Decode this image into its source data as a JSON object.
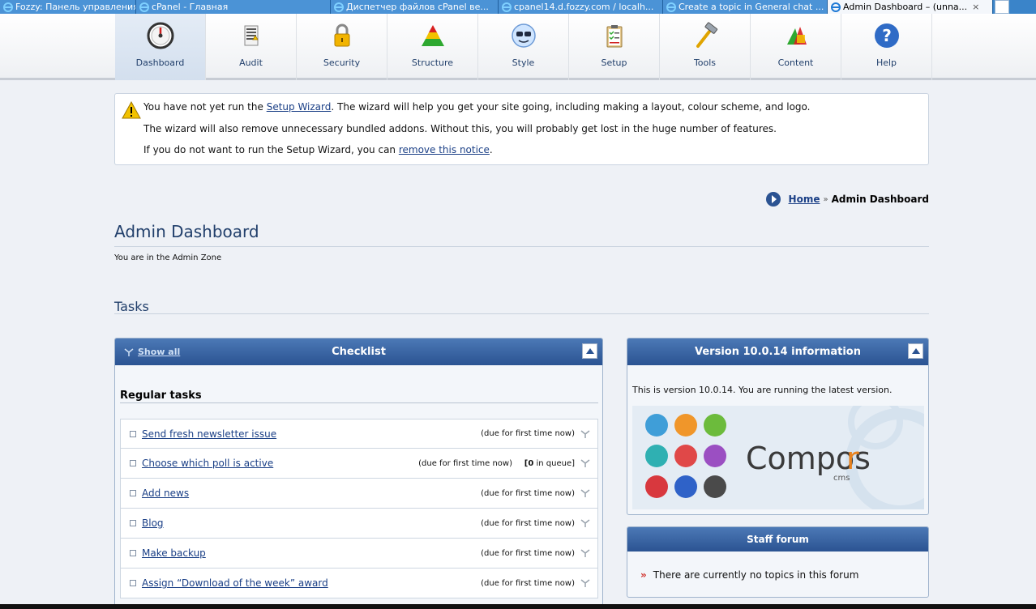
{
  "browser_tabs": [
    {
      "title": "Fozzy: Панель управления",
      "active": false
    },
    {
      "title": "cPanel - Главная",
      "active": false
    },
    {
      "title": "Диспетчер файлов cPanel ве...",
      "active": false
    },
    {
      "title": "cpanel14.d.fozzy.com / localh...",
      "active": false
    },
    {
      "title": "Create a topic in General chat ...",
      "active": false
    },
    {
      "title": "Admin Dashboard – (unna...",
      "active": true
    }
  ],
  "tab_close": "×",
  "toolbar": {
    "items": [
      {
        "label": "Dashboard",
        "icon": "dashboard-gauge-icon",
        "active": true
      },
      {
        "label": "Audit",
        "icon": "audit-icon",
        "active": false
      },
      {
        "label": "Security",
        "icon": "padlock-icon",
        "active": false
      },
      {
        "label": "Structure",
        "icon": "pyramid-icon",
        "active": false
      },
      {
        "label": "Style",
        "icon": "sunglasses-face-icon",
        "active": false
      },
      {
        "label": "Setup",
        "icon": "clipboard-checklist-icon",
        "active": false
      },
      {
        "label": "Tools",
        "icon": "hammer-icon",
        "active": false
      },
      {
        "label": "Content",
        "icon": "content-shapes-icon",
        "active": false
      },
      {
        "label": "Help",
        "icon": "question-icon",
        "active": false
      }
    ]
  },
  "notice": {
    "line1_pre": "You have not yet run the ",
    "line1_link": "Setup Wizard",
    "line1_post": ". The wizard will help you get your site going, including making a layout, colour scheme, and logo.",
    "line2": "The wizard will also remove unnecessary bundled addons. Without this, you will probably get lost in the huge number of features.",
    "line3_pre": "If you do not want to run the Setup Wizard, you can ",
    "line3_link": "remove this notice",
    "line3_post": "."
  },
  "breadcrumb": {
    "home": "Home",
    "separator": "»",
    "current": "Admin Dashboard"
  },
  "page": {
    "title": "Admin Dashboard",
    "subtitle": "You are in the Admin Zone",
    "tasks_heading": "Tasks"
  },
  "checklist": {
    "title": "Checklist",
    "show_all": "Show all",
    "section_title": "Regular tasks",
    "tasks": [
      {
        "name": "Send fresh newsletter issue",
        "due": "(due for first time now)",
        "queue": ""
      },
      {
        "name": "Choose which poll is active",
        "due": "(due for first time now)",
        "queue": "[0 in queue]"
      },
      {
        "name": "Add news",
        "due": "(due for first time now)",
        "queue": ""
      },
      {
        "name": "Blog",
        "due": "(due for first time now)",
        "queue": ""
      },
      {
        "name": "Make backup",
        "due": "(due for first time now)",
        "queue": ""
      },
      {
        "name": "Assign “Download of the week” award",
        "due": "(due for first time now)",
        "queue": ""
      }
    ]
  },
  "version_box": {
    "title": "Version 10.0.14 information",
    "text": "This is version 10.0.14. You are running the latest version.",
    "logo_word": "Compos",
    "logo_r": "r",
    "logo_sub": "cms"
  },
  "staff_forum": {
    "title": "Staff forum",
    "bullet": "»",
    "text": "There are currently no topics in this forum"
  },
  "colors": {
    "accent": "#2b5392",
    "link": "#1a3f86",
    "page_bg": "#eef1f6"
  }
}
